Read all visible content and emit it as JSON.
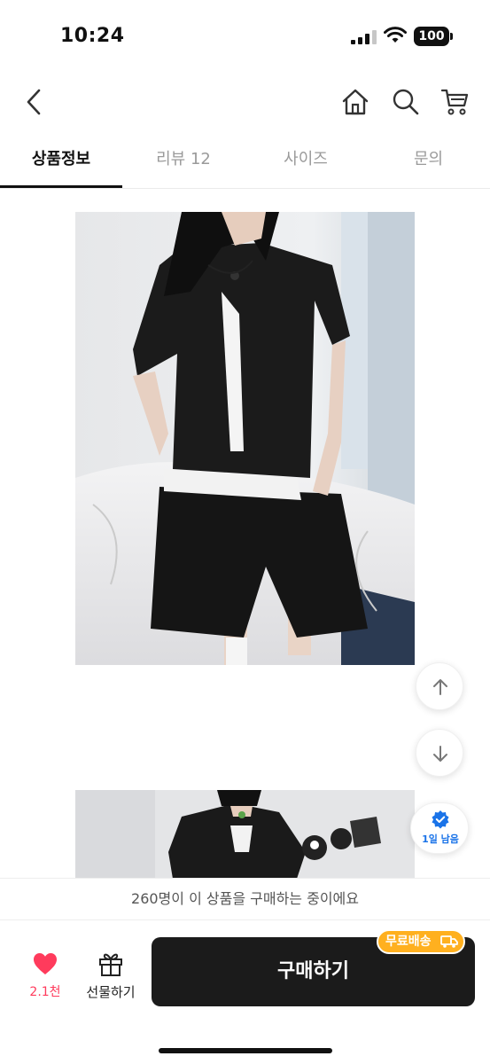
{
  "status_bar": {
    "time": "10:24",
    "battery": "100"
  },
  "nav": {
    "icons": [
      "back-chevron-icon",
      "home-icon",
      "search-icon",
      "cart-icon"
    ]
  },
  "tabs": [
    {
      "label": "상품정보",
      "active": true
    },
    {
      "label": "리뷰 12",
      "active": false
    },
    {
      "label": "사이즈",
      "active": false
    },
    {
      "label": "문의",
      "active": false
    }
  ],
  "floating": {
    "stock_label": "1일 남음"
  },
  "buyers_notice": "260명이 이 상품을 구매하는 중이에요",
  "bottom": {
    "like_count": "2.1천",
    "gift_label": "선물하기",
    "buy_label": "구매하기",
    "free_shipping": "무료배송"
  },
  "colors": {
    "accent_like": "#ff3b5c",
    "buy_button": "#1b1b1b",
    "free_shipping_badge": "#ffb01f",
    "stock_blue": "#1a73e8"
  }
}
